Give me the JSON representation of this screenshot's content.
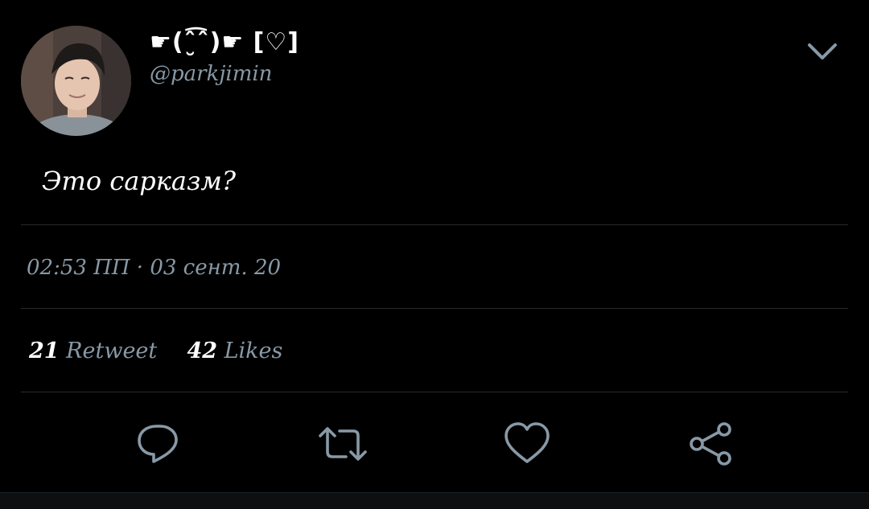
{
  "tweet": {
    "display_name": "☛(ˆ̮͡ˆ)☛ [♡]",
    "handle": "@parkjimin",
    "text": "Это сарказм?",
    "timestamp": "02:53 ПП · 03 сент. 20",
    "retweet_count": "21",
    "retweet_label": "Retweet",
    "like_count": "42",
    "like_label": "Likes"
  },
  "colors": {
    "background": "#000000",
    "primary_text": "#ffffff",
    "secondary_text": "#8899a6",
    "icon": "#8899a6",
    "divider": "#262a2e"
  },
  "icons": {
    "menu": "chevron-down-icon",
    "reply": "reply-icon",
    "retweet": "retweet-icon",
    "like": "heart-icon",
    "share": "share-icon"
  }
}
